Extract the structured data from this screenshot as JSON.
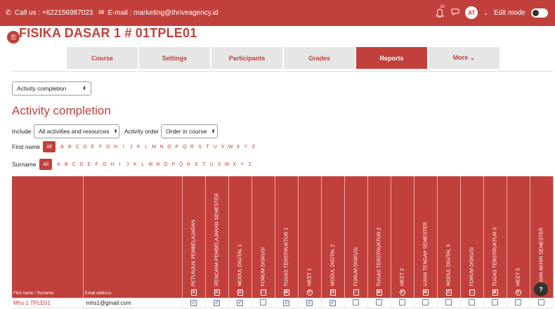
{
  "topbar": {
    "phone_icon": "phone-icon",
    "phone_text": "Call us : +622156987023",
    "mail_icon": "mail-icon",
    "email_text": "E-mail : marketing@thriveagency.id",
    "notif_count": "10",
    "avatar_initials": "AT",
    "edit_mode_label": "Edit mode"
  },
  "course": {
    "title": "FISIKA DASAR 1 # 01TPLE01"
  },
  "tabs": [
    {
      "label": "Course"
    },
    {
      "label": "Settings"
    },
    {
      "label": "Participants"
    },
    {
      "label": "Grades"
    },
    {
      "label": "Reports"
    },
    {
      "label": "More ⌄"
    }
  ],
  "report_select": {
    "value": "Activity completion"
  },
  "heading": "Activity completion",
  "filters": {
    "include_label": "Include",
    "include_value": "All activities and resources",
    "order_label": "Activity order",
    "order_value": "Order in course"
  },
  "firstname": {
    "label": "First name",
    "all": "All",
    "letters": [
      "A",
      "B",
      "C",
      "D",
      "E",
      "F",
      "G",
      "H",
      "I",
      "J",
      "K",
      "L",
      "M",
      "N",
      "O",
      "P",
      "Q",
      "R",
      "S",
      "T",
      "U",
      "V",
      "W",
      "X",
      "Y",
      "Z"
    ]
  },
  "surname": {
    "label": "Surname",
    "all": "All",
    "letters": [
      "A",
      "B",
      "C",
      "D",
      "E",
      "F",
      "G",
      "H",
      "I",
      "J",
      "K",
      "L",
      "M",
      "N",
      "O",
      "P",
      "Q",
      "R",
      "S",
      "T",
      "U",
      "V",
      "W",
      "X",
      "Y",
      "Z"
    ]
  },
  "table": {
    "col_name": "First name / Surname",
    "col_email": "Email address",
    "activities": [
      {
        "name": "PETUNJUK PEMBELAJARAN",
        "icon": "file-icon",
        "glyph": "▤"
      },
      {
        "name": "RENCANA PEMBELAJARAN SEMESTER",
        "icon": "file-icon",
        "glyph": "▤"
      },
      {
        "name": "MODUL DIGITAL 1",
        "icon": "file-icon",
        "glyph": "▤"
      },
      {
        "name": "FORUM DISKUSI",
        "icon": "forum-icon",
        "glyph": "▭"
      },
      {
        "name": "TUGAS TERSTRUKTUR 1",
        "icon": "assignment-icon",
        "glyph": "▣"
      },
      {
        "name": "MEET 1",
        "icon": "globe-icon",
        "glyph": "⊕"
      },
      {
        "name": "MODUL DIGITAL 2",
        "icon": "file-icon",
        "glyph": "▤"
      },
      {
        "name": "FORUM DISKUSI",
        "icon": "forum-icon",
        "glyph": "▭"
      },
      {
        "name": "TUGAS TERSTRUKTUR 2",
        "icon": "assignment-icon",
        "glyph": "▣"
      },
      {
        "name": "MEET 2",
        "icon": "globe-icon",
        "glyph": "⊕"
      },
      {
        "name": "UJIAN TENGAH SEMESTER",
        "icon": "assignment-icon",
        "glyph": "▣"
      },
      {
        "name": "MODUL DIGITAL 3",
        "icon": "file-icon",
        "glyph": "▤"
      },
      {
        "name": "FORUM DISKUSI",
        "icon": "forum-icon",
        "glyph": "▭"
      },
      {
        "name": "TUGAS TERSTRUKTUR 3",
        "icon": "assignment-icon",
        "glyph": "▣"
      },
      {
        "name": "MEET 3",
        "icon": "globe-icon",
        "glyph": "⊕"
      },
      {
        "name": "UJIAN AKHIR SEMESTER",
        "icon": "assignment-icon",
        "glyph": "▣"
      }
    ],
    "rows": [
      {
        "name": "Mhs 1 TPLE01",
        "email": "mhs1@gmail.com",
        "completion": [
          true,
          true,
          true,
          false,
          true,
          true,
          true,
          false,
          false,
          false,
          false,
          false,
          false,
          false,
          false,
          false
        ]
      }
    ]
  },
  "help_label": "?"
}
